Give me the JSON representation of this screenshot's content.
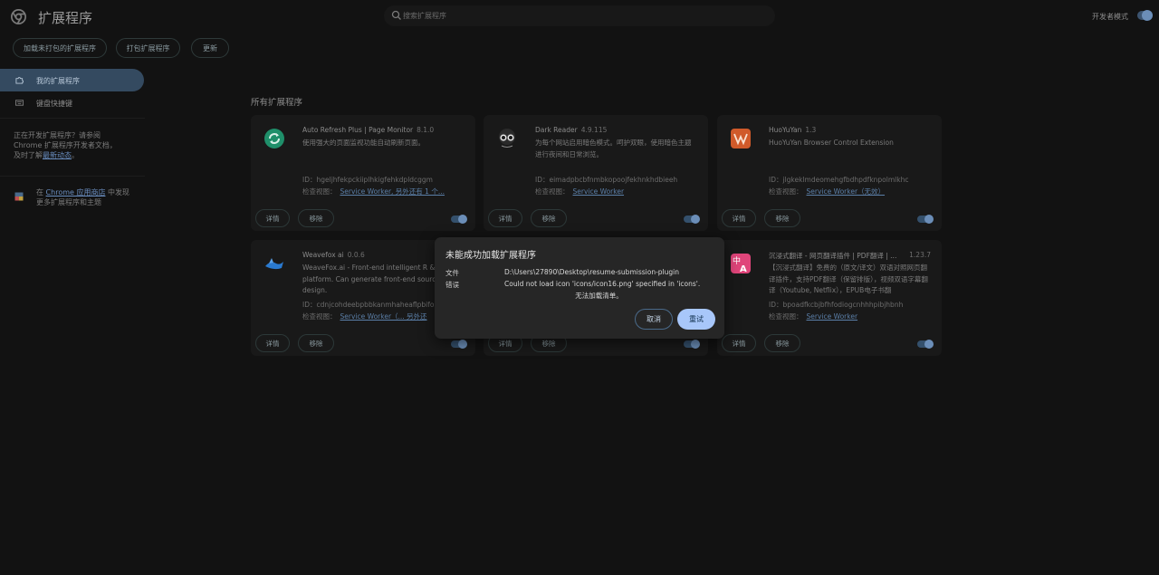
{
  "header": {
    "title": "扩展程序",
    "search_placeholder": "搜索扩展程序",
    "dev_mode_label": "开发者模式"
  },
  "toolbar": {
    "load_unpacked": "加载未打包的扩展程序",
    "pack": "打包扩展程序",
    "update": "更新"
  },
  "sidebar": {
    "my_extensions": "我的扩展程序",
    "shortcuts": "键盘快捷键",
    "dev_note_1": "正在开发扩展程序？请参阅 Chrome 扩展程序开发者文档，及时了解",
    "dev_note_link": "最新动态",
    "dev_note_end": "。",
    "store_pre": "在 ",
    "store_link": "Chrome 应用商店",
    "store_post": " 中发现更多扩展程序和主题"
  },
  "section_title": "所有扩展程序",
  "labels": {
    "details": "详情",
    "remove": "移除",
    "inspect": "检查视图："
  },
  "cards": [
    {
      "name": "Auto Refresh Plus | Page Monitor",
      "version": "8.1.0",
      "desc": "使用强大的页面监视功能自动刷新页面。",
      "id": "ID：hgeljhfekpckiiplhkigfehkdpldcggm",
      "view": "Service Worker, 另外还有 1 个..."
    },
    {
      "name": "Dark Reader",
      "version": "4.9.115",
      "desc": "为每个网站启用暗色模式。呵护双眼，使用暗色主题进行夜间和日常浏览。",
      "id": "ID：eimadpbcbfnmbkopoojfekhnkhdbieeh",
      "view": "Service Worker"
    },
    {
      "name": "HuoYuYan",
      "version": "1.3",
      "desc": "HuoYuYan Browser Control Extension",
      "id": "ID：jlgkeklmdeomehgfbdhpdfknpolmlkhc",
      "view": "Service Worker（无效）"
    },
    {
      "name": "Weavefox ai",
      "version": "0.0.6",
      "desc": "WeaveFox.ai - Front-end intelligent R & D platform. Can generate front-end source from design.",
      "id": "ID：cdnjcohdeebpbbkanmhaheaflpbifop",
      "view": "Service Worker（...  另外还"
    },
    {
      "name": "",
      "version": "",
      "desc": "",
      "id": "",
      "view": ""
    },
    {
      "name": "沉浸式翻译 - 网页翻译插件 | PDF翻译 | ...",
      "version": "1.23.7",
      "desc": "【沉浸式翻译】免费的（原文/译文）双语对照网页翻译插件，支持PDF翻译（保留排版），视频双语字幕翻译（Youtube, Netflix），EPUB电子书翻",
      "id": "ID：bpoadfkcbjbfhfodiogcnhhhpibjhbnh",
      "view": "Service Worker"
    }
  ],
  "dialog": {
    "title": "未能成功加载扩展程序",
    "file_label": "文件",
    "file_value": "D:\\Users\\27890\\Desktop\\resume-submission-plugin",
    "error_label": "错误",
    "error_value": "Could not load icon 'icons/icon16.png' specified in 'icons'.",
    "error_note": "无法加载清单。",
    "cancel": "取消",
    "retry": "重试"
  },
  "colors": {
    "background": "#121212",
    "card": "#191919",
    "accent": "#a8c7fa",
    "sidebar_active": "#344a60"
  }
}
